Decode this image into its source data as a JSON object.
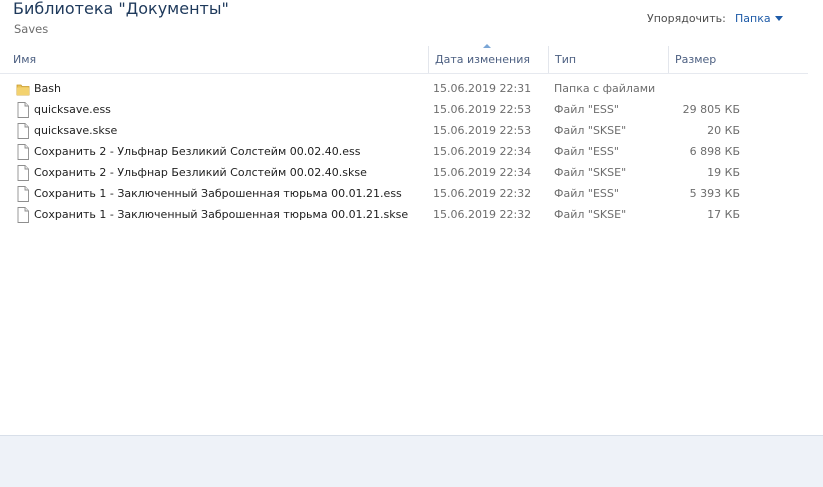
{
  "header": {
    "library_title": "Библиотека \"Документы\"",
    "folder_name": "Saves",
    "arrange_label": "Упорядочить:",
    "arrange_value": "Папка"
  },
  "columns": {
    "name": "Имя",
    "date": "Дата изменения",
    "type": "Тип",
    "size": "Размер"
  },
  "files": [
    {
      "icon": "folder-icon",
      "name": "Bash",
      "date": "15.06.2019 22:31",
      "type": "Папка с файлами",
      "size": ""
    },
    {
      "icon": "file-icon",
      "name": "quicksave.ess",
      "date": "15.06.2019 22:53",
      "type": "Файл \"ESS\"",
      "size": "29 805 КБ"
    },
    {
      "icon": "file-icon",
      "name": "quicksave.skse",
      "date": "15.06.2019 22:53",
      "type": "Файл \"SKSE\"",
      "size": "20 КБ"
    },
    {
      "icon": "file-icon",
      "name": "Сохранить 2 - Ульфнар Безликий  Солстейм  00.02.40.ess",
      "date": "15.06.2019 22:34",
      "type": "Файл \"ESS\"",
      "size": "6 898 КБ"
    },
    {
      "icon": "file-icon",
      "name": "Сохранить 2 - Ульфнар Безликий  Солстейм  00.02.40.skse",
      "date": "15.06.2019 22:34",
      "type": "Файл \"SKSE\"",
      "size": "19 КБ"
    },
    {
      "icon": "file-icon",
      "name": "Сохранить 1 - Заключенный  Заброшенная тюрьма  00.01.21.ess",
      "date": "15.06.2019 22:32",
      "type": "Файл \"ESS\"",
      "size": "5 393 КБ"
    },
    {
      "icon": "file-icon",
      "name": "Сохранить 1 - Заключенный  Заброшенная тюрьма  00.01.21.skse",
      "date": "15.06.2019 22:32",
      "type": "Файл \"SKSE\"",
      "size": "17 КБ"
    }
  ]
}
